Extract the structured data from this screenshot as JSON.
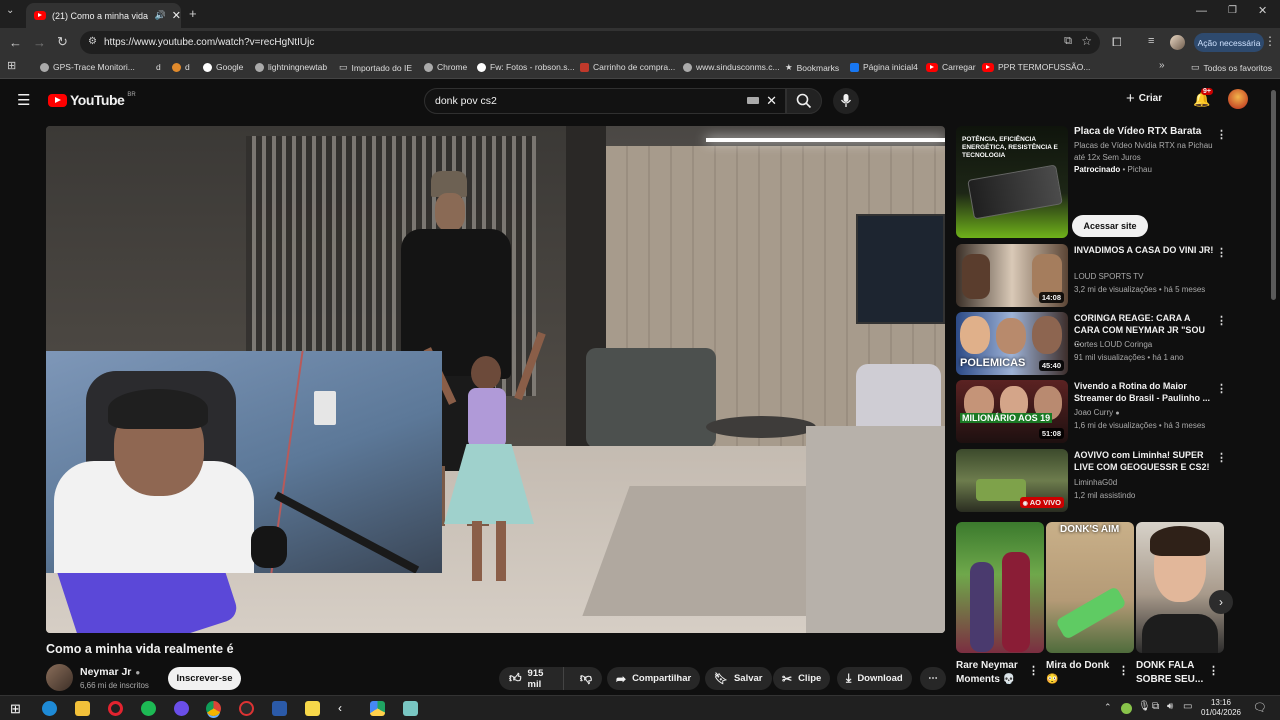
{
  "browser": {
    "tab_title": "(21) Como a minha vida rec",
    "url": "https://www.youtube.com/watch?v=recHgNtIUjc",
    "action_label": "Ação necessária",
    "bookmarks": [
      "GPS-Trace Monitori...",
      "d",
      "d",
      "Google",
      "lightningnewtab",
      "Importado do IE",
      "Chrome",
      "Fw: Fotos - robson.s...",
      "Carrinho de compra...",
      "www.sindusconms.c...",
      "Bookmarks",
      "Página inicial4",
      "Carregar",
      "PPR TERMOFUSSÃO..."
    ],
    "all_favorites": "Todos os favoritos"
  },
  "youtube": {
    "logo": "YouTube",
    "region": "BR",
    "search_query": "donk pov cs2",
    "create_label": "Criar",
    "notifications_count": "9+"
  },
  "video": {
    "title": "Como a minha vida realmente é",
    "channel": "Neymar Jr",
    "subscribers": "6,66 mi de inscritos",
    "subscribe_label": "Inscrever-se",
    "likes": "915 mil",
    "share_label": "Compartilhar",
    "save_label": "Salvar",
    "clip_label": "Clipe",
    "download_label": "Download"
  },
  "ad": {
    "title": "Placa de Vídeo RTX Barata",
    "desc": "Placas de Vídeo Nvidia RTX na Pichau até 12x Sem Juros",
    "sponsored": "Patrocinado",
    "advertiser": "Pichau",
    "cta": "Acessar site",
    "thumb_text": "POTÊNCIA, EFICIÊNCIA ENERGÉTICA, RESISTÊNCIA E TECNOLOGIA"
  },
  "recommendations": [
    {
      "title": "INVADIMOS A CASA DO VINI JR!",
      "channel": "LOUD SPORTS TV",
      "meta": "3,2 mi de visualizações • há 5 meses",
      "duration": "14:08",
      "thumb_text": ""
    },
    {
      "title": "CORINGA REAGE: CARA A CARA COM NEYMAR JR \"SOU ...",
      "channel": "Cortes LOUD Coringa",
      "meta": "91 mil visualizações • há 1 ano",
      "duration": "45:40",
      "thumb_text": "POLEMICAS"
    },
    {
      "title": "Vivendo a Rotina do Maior Streamer do Brasil - Paulinho ...",
      "channel": "Joao Curry",
      "meta": "1,6 mi de visualizações • há 3 meses",
      "duration": "51:08",
      "thumb_text": "MILIONÁRIO AOS 19"
    },
    {
      "title": "AOVIVO com Liminha! SUPER LIVE COM GEOGUESSR E CS2!",
      "channel": "LiminhaG0d",
      "meta": "1,2 mil assistindo",
      "duration": "AO VIVO",
      "thumb_text": ""
    }
  ],
  "shorts": [
    {
      "title": "Rare Neymar Moments 💀",
      "thumb_text": ""
    },
    {
      "title": "Mira do Donk 😳",
      "thumb_text": "DONK'S AIM"
    },
    {
      "title": "DONK FALA SOBRE SEU...",
      "thumb_text": ""
    }
  ],
  "taskbar": {
    "time": "13:16",
    "date": "01/04/2026"
  }
}
